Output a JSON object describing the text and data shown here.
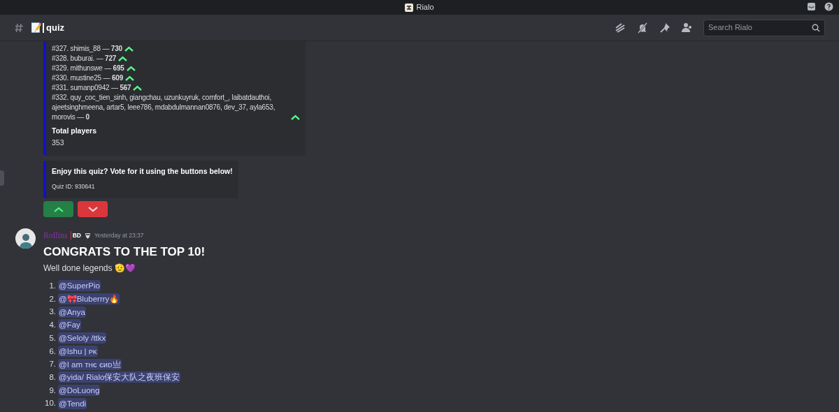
{
  "window": {
    "title": "Rialo"
  },
  "channel": {
    "emoji": "📝",
    "name": "quiz",
    "search": {
      "placeholder": "Search Rialo"
    }
  },
  "leaderboard": {
    "rows": [
      {
        "text": "#327. shimis_88 — **730**"
      },
      {
        "text": "#328. buburai. — **727**"
      },
      {
        "text": "#329. mithunswe — **695**"
      },
      {
        "text": "#330. mustine25 — **609**"
      },
      {
        "text": "#331. sumanp0942 — **567**"
      },
      {
        "text": "#332. quy_coc_tien_sinh, giangchau, uzunkuyruk, comfort_, laibatdauthoi, ajeetsinghmeena, artar5, leee786, mdabdulmannan0876, dev_37, ayla653, morovis — **0**"
      }
    ],
    "total_label": "Total players",
    "total_value": "353"
  },
  "vote": {
    "title": "Enjoy this quiz? Vote for it using the buttons below!",
    "quiz_id": "Quiz ID: 930641"
  },
  "message": {
    "author": "Rollins",
    "tag": "BD",
    "timestamp": "Yesterday at 23:37",
    "heading": "CONGRATS TO THE TOP 10!",
    "text": "Well done legends 🫡💜",
    "mentions": [
      {
        "number": "1.",
        "name": "@SuperPio"
      },
      {
        "number": "2.",
        "name": "@🎀Bluberrry🔥"
      },
      {
        "number": "3.",
        "name": "@Anya"
      },
      {
        "number": "4.",
        "name": "@Fay"
      },
      {
        "number": "5.",
        "name": "@Seloly /ttkx"
      },
      {
        "number": "6.",
        "name": "@Ishu | ᴘᴋ"
      },
      {
        "number": "7.",
        "name": "@I am ᴛʜє єиᴅ亗"
      },
      {
        "number": "8.",
        "name": "@yida/ Rialo保安大队之夜班保安"
      },
      {
        "number": "9.",
        "name": "@DoLuong"
      },
      {
        "number": "10.",
        "name": "@Tendi"
      }
    ]
  }
}
